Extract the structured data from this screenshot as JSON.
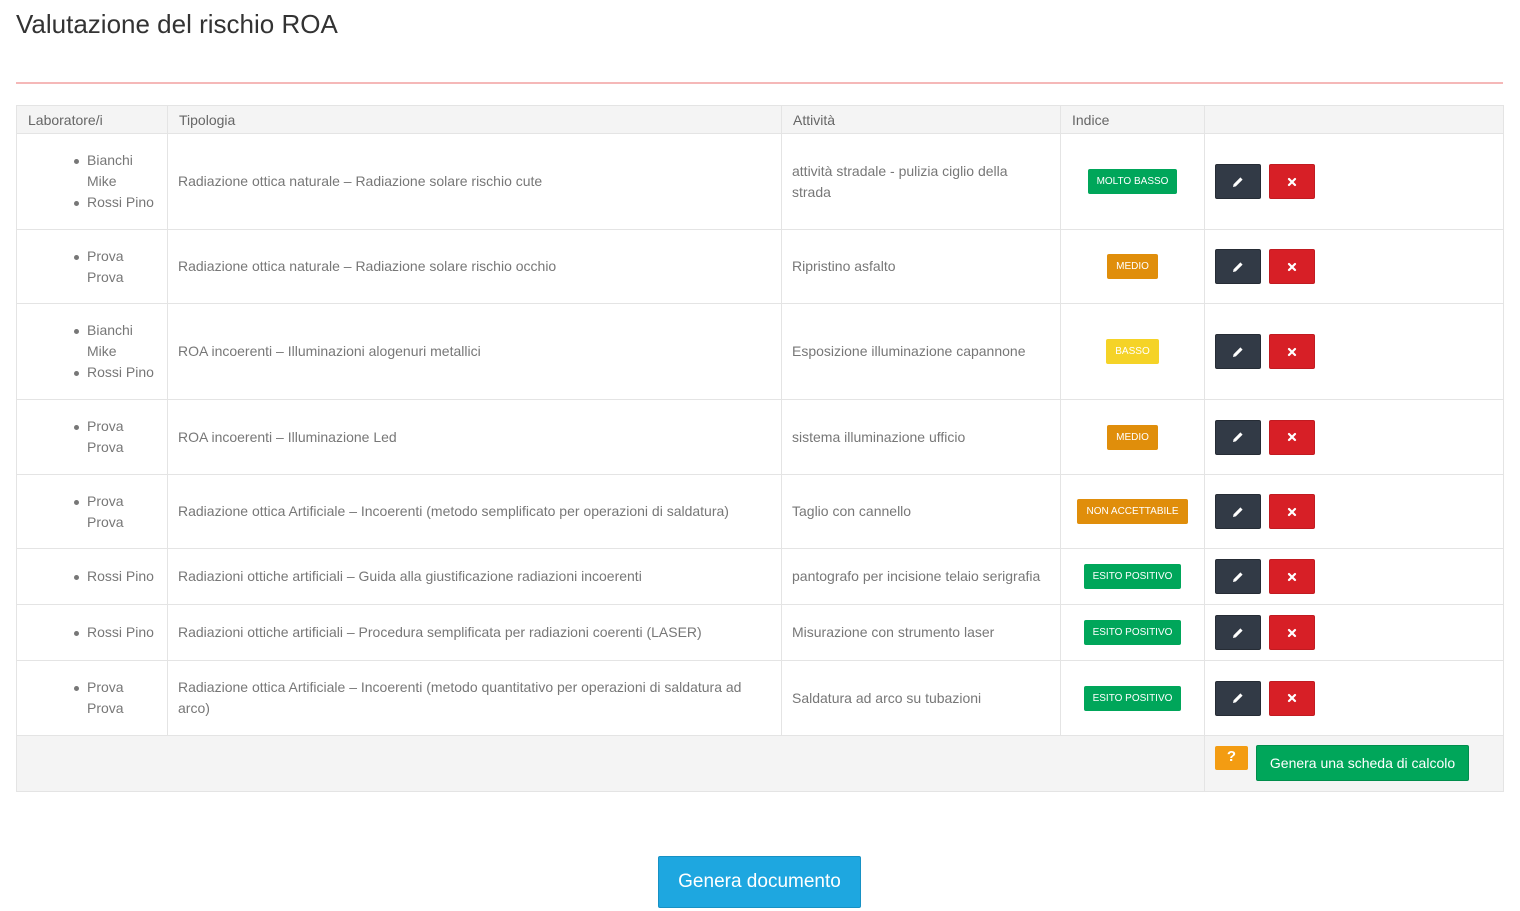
{
  "page": {
    "title": "Valutazione del rischio ROA"
  },
  "colors": {
    "molto_basso": "#00a65a",
    "medio": "#e08e0b",
    "basso": "#f5d327",
    "non_accettabile": "#e08e0b",
    "esito_positivo": "#00a65a",
    "edit_button": "#323a46",
    "delete_button": "#d71f26",
    "help_button": "#f39c12",
    "primary": "#1ea7e0"
  },
  "table": {
    "headers": {
      "lab": "Laboratore/i",
      "tipologia": "Tipologia",
      "attivita": "Attività",
      "indice": "Indice",
      "actions": ""
    },
    "rows": [
      {
        "labs": [
          "Bianchi Mike",
          "Rossi Pino"
        ],
        "tipologia": "Radiazione ottica naturale – Radiazione solare rischio cute",
        "attivita": "attività stradale - pulizia ciglio della strada",
        "indice": "MOLTO BASSO",
        "indice_color": "#00a65a",
        "indice_text_color": "#ffffff"
      },
      {
        "labs": [
          "Prova Prova"
        ],
        "tipologia": "Radiazione ottica naturale – Radiazione solare rischio occhio",
        "attivita": "Ripristino asfalto",
        "indice": "MEDIO",
        "indice_color": "#e08e0b",
        "indice_text_color": "#ffffff"
      },
      {
        "labs": [
          "Bianchi Mike",
          "Rossi Pino"
        ],
        "tipologia": "ROA incoerenti – Illuminazioni alogenuri metallici",
        "attivita": "Esposizione illuminazione capannone",
        "indice": "BASSO",
        "indice_color": "#f5d327",
        "indice_text_color": "#ffffff"
      },
      {
        "labs": [
          "Prova Prova"
        ],
        "tipologia": "ROA incoerenti – Illuminazione Led",
        "attivita": "sistema illuminazione ufficio",
        "indice": "MEDIO",
        "indice_color": "#e08e0b",
        "indice_text_color": "#ffffff"
      },
      {
        "labs": [
          "Prova Prova"
        ],
        "tipologia": "Radiazione ottica Artificiale – Incoerenti (metodo semplificato per operazioni di saldatura)",
        "attivita": "Taglio con cannello",
        "indice": "NON ACCETTABILE",
        "indice_color": "#e08e0b",
        "indice_text_color": "#ffffff"
      },
      {
        "labs": [
          "Rossi Pino"
        ],
        "tipologia": "Radiazioni ottiche artificiali – Guida alla giustificazione radiazioni incoerenti",
        "attivita": "pantografo per incisione telaio serigrafia",
        "indice": "ESITO POSITIVO",
        "indice_color": "#00a65a",
        "indice_text_color": "#ffffff"
      },
      {
        "labs": [
          "Rossi Pino"
        ],
        "tipologia": "Radiazioni ottiche artificiali – Procedura semplificata per radiazioni coerenti (LASER)",
        "attivita": "Misurazione con strumento laser",
        "indice": "ESITO POSITIVO",
        "indice_color": "#00a65a",
        "indice_text_color": "#ffffff"
      },
      {
        "labs": [
          "Prova Prova"
        ],
        "tipologia": "Radiazione ottica Artificiale – Incoerenti (metodo quantitativo per operazioni di saldatura ad arco)",
        "attivita": "Saldatura ad arco su tubazioni",
        "indice": "ESITO POSITIVO",
        "indice_color": "#00a65a",
        "indice_text_color": "#ffffff"
      }
    ],
    "footer": {
      "help_label": "?",
      "generate_sheet_label": "Genera una scheda di calcolo"
    }
  },
  "icons": {
    "edit": "pencil-icon",
    "delete": "close-icon"
  },
  "actions": {
    "generate_document_label": "Genera documento"
  }
}
